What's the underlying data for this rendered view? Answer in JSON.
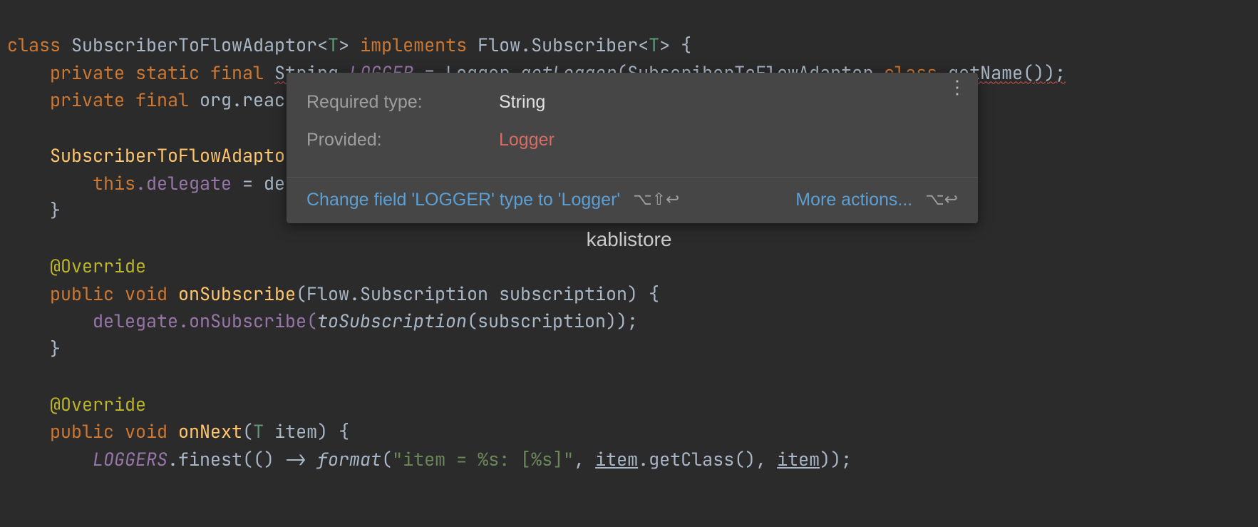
{
  "code": {
    "class": "class ",
    "classname": "SubscriberToFlowAdaptor",
    "generic_open": "<",
    "T": "T",
    "generic_close": ">",
    "implements": " implements ",
    "flow_sub": "Flow.Subscriber",
    "brace_open": " {",
    "l2_mod": "private static final ",
    "l2_type": "String ",
    "l2_field": "LOGGER",
    "l2_eq": " = ",
    "l2_logger": "Logger",
    "l2_dot": ".",
    "l2_getLogger": "getLogger",
    "l2_arg": "(SubscriberToFlowAdaptor.",
    "l2_classkw": "class",
    "l2_getname": ".getName());",
    "l3_mod": "private final ",
    "l3_rest": "org.reac",
    "ctor": "SubscriberToFlowAdaptor",
    "thiskw": "this",
    "delegate_field": ".delegate",
    "eq_de": " = de",
    "override": "@Override",
    "public_void": "public void ",
    "onSubscribe": "onSubscribe",
    "onSub_params": "(Flow.Subscription subscription) {",
    "delegate_call": "delegate.onSubscribe(",
    "toSubscription": "toSubscription",
    "toSub_end": "(subscription));",
    "onNext": "onNext",
    "onNext_params_open": "(",
    "onNext_params_rest": " item) {",
    "loggers": "LOGGERS",
    "finest": ".finest(() -> ",
    "format": "format",
    "fmt_open": "(",
    "fmt_str": "\"item = %s: [%s]\"",
    "fmt_comma": ", ",
    "item1": "item",
    "getClass": ".getClass(), ",
    "item2": "item",
    "tail_paren": "));",
    "brace_close": "}"
  },
  "popup": {
    "required_label": "Required type:",
    "required_value": "String",
    "provided_label": "Provided:",
    "provided_value": "Logger",
    "action_text": "Change field 'LOGGER' type to 'Logger'",
    "action_shortcut": "⌥⇧↩",
    "more_text": "More actions...",
    "more_shortcut": "⌥↩"
  },
  "watermark": "kablistore"
}
